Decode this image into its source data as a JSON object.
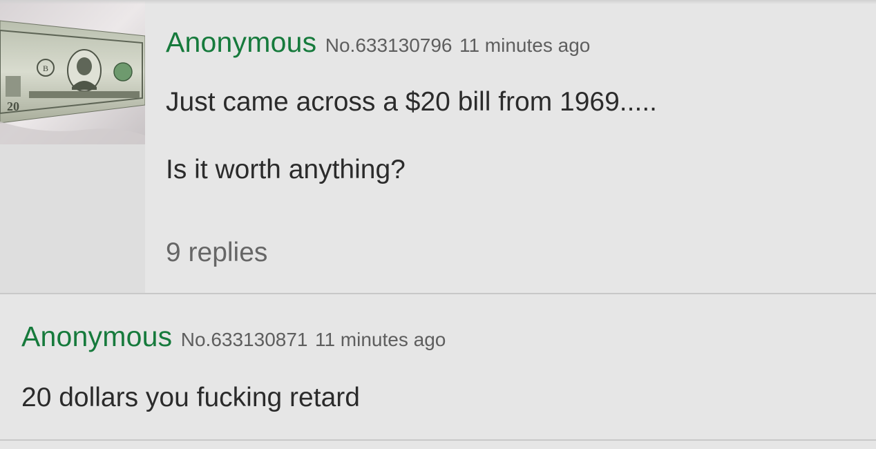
{
  "op": {
    "name": "Anonymous",
    "post_number": "No.633130796",
    "time_ago": "11 minutes ago",
    "message_lines": [
      "Just came across a $20 bill from 1969.....",
      "Is it worth anything?"
    ],
    "replies_label": "9 replies",
    "thumbnail_alt": "twenty-dollar-bill-image"
  },
  "replies": [
    {
      "name": "Anonymous",
      "post_number": "No.633130871",
      "time_ago": "11 minutes ago",
      "message": "20 dollars you fucking retard"
    }
  ],
  "colors": {
    "background": "#e6e6e6",
    "name_green": "#167a3c",
    "meta_gray": "#5e5e5e",
    "text": "#2b2b2b",
    "divider": "#c8c8c8"
  }
}
